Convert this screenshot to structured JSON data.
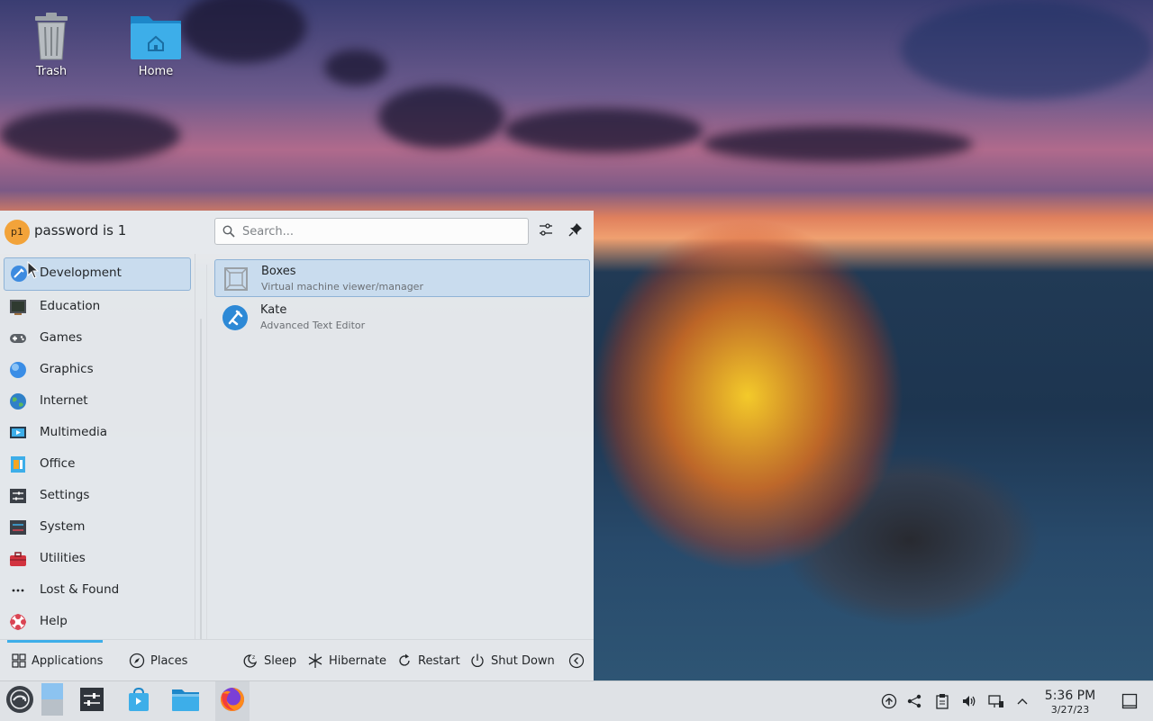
{
  "desktop": {
    "icons": [
      {
        "label": "Trash",
        "icon": "trash-icon"
      },
      {
        "label": "Home",
        "icon": "home-folder-icon"
      }
    ]
  },
  "menu": {
    "user_initials": "p1",
    "user_name": "password is 1",
    "search_placeholder": "Search...",
    "categories": [
      {
        "label": "Development",
        "icon": "development-icon",
        "selected": true
      },
      {
        "label": "Education",
        "icon": "education-icon"
      },
      {
        "label": "Games",
        "icon": "gamepad-icon"
      },
      {
        "label": "Graphics",
        "icon": "graphics-icon"
      },
      {
        "label": "Internet",
        "icon": "globe-icon"
      },
      {
        "label": "Multimedia",
        "icon": "multimedia-icon"
      },
      {
        "label": "Office",
        "icon": "office-icon"
      },
      {
        "label": "Settings",
        "icon": "settings-icon"
      },
      {
        "label": "System",
        "icon": "system-icon"
      },
      {
        "label": "Utilities",
        "icon": "toolbox-icon"
      },
      {
        "label": "Lost & Found",
        "icon": "ellipsis-icon"
      },
      {
        "label": "Help",
        "icon": "help-lifebuoy-icon"
      }
    ],
    "apps": [
      {
        "name": "Boxes",
        "description": "Virtual machine viewer/manager",
        "icon": "boxes-icon",
        "selected": true
      },
      {
        "name": "Kate",
        "description": "Advanced Text Editor",
        "icon": "kate-icon"
      }
    ],
    "footer": {
      "applications": "Applications",
      "places": "Places",
      "sleep": "Sleep",
      "hibernate": "Hibernate",
      "restart": "Restart",
      "shutdown": "Shut Down"
    }
  },
  "taskbar": {
    "time": "5:36 PM",
    "date": "3/27/23"
  },
  "colors": {
    "accent": "#3daee9",
    "selection_bg": "#c9dcee",
    "selection_border": "#8fb3d6",
    "panel_bg": "#dfe2e6"
  }
}
